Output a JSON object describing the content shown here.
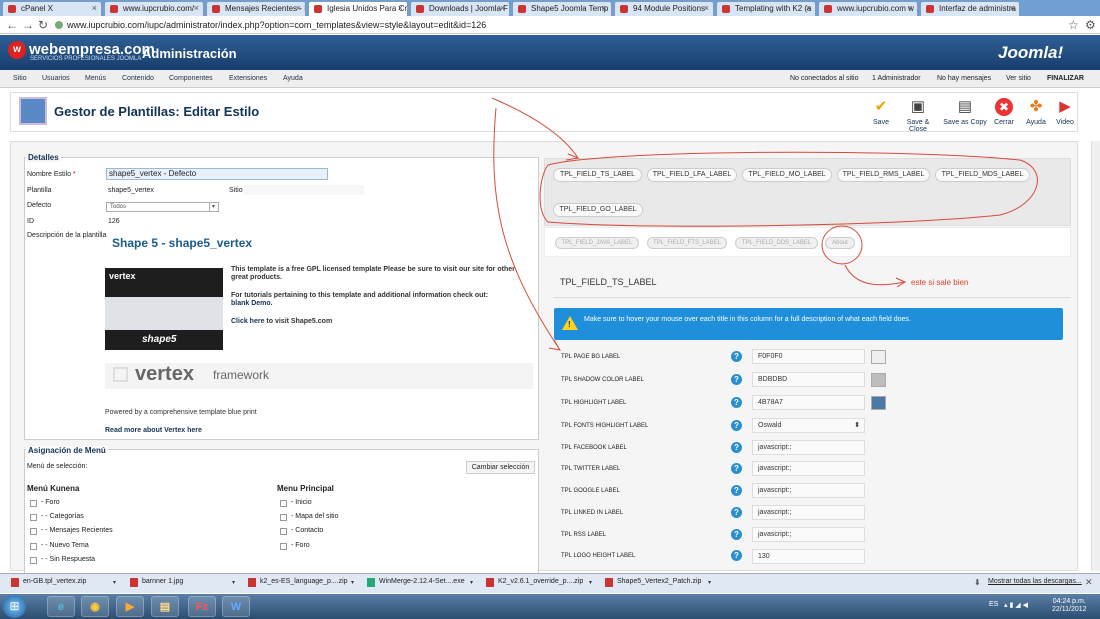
{
  "browser": {
    "tabs": [
      {
        "label": "cPanel X"
      },
      {
        "label": "www.iupcrubio.com/"
      },
      {
        "label": "Mensajes Recientes - I"
      },
      {
        "label": "Iglesia Unidos Para Cr"
      },
      {
        "label": "Downloads | Joomla F"
      },
      {
        "label": "Shape5 Joomla Temp"
      },
      {
        "label": "94 Module Positions"
      },
      {
        "label": "Templating with K2 (a"
      },
      {
        "label": "www.iupcrubio.com w"
      },
      {
        "label": "Interfaz de administra"
      }
    ],
    "url": "www.iupcrubio.com/iupc/administrator/index.php?option=com_templates&view=style&layout=edit&id=126"
  },
  "header": {
    "brand": "webempresa.com",
    "brand_sub": "SERVICIOS PROFESIONALES JOOMLA",
    "title": "Administración",
    "joomla": "Joomla!"
  },
  "menu": [
    "Sitio",
    "Usuarios",
    "Menús",
    "Contenido",
    "Componentes",
    "Extensiones",
    "Ayuda"
  ],
  "status": {
    "not_connected": "No conectados al sitio",
    "admins": "1 Administrador",
    "messages": "No hay mensajes",
    "view_site": "Ver sitio",
    "logout": "FINALIZAR"
  },
  "toolbar": {
    "page_title": "Gestor de Plantillas: Editar Estilo",
    "buttons": [
      {
        "label": "Save"
      },
      {
        "label": "Save & Close"
      },
      {
        "label": "Save as Copy"
      },
      {
        "label": "Cerrar"
      },
      {
        "label": "Ayuda"
      },
      {
        "label": "Video"
      }
    ]
  },
  "details": {
    "legend": "Detalles",
    "nombre_label": "Nombre Estilo",
    "required_mark": "*",
    "nombre_value": "shape5_vertex - Defecto",
    "plantilla_label": "Plantilla",
    "plantilla_value": "shape5_vertex",
    "sitio_label": "Sitio",
    "defecto_label": "Defecto",
    "defecto_value": "Todos",
    "id_label": "ID",
    "id_value": "126",
    "desc_label": "Descripción de la plantilla",
    "tpl_name": "Shape 5 - shape5_vertex",
    "image_text": "vertex",
    "image_sub": "shape5",
    "desc1": "This template is a free GPL licensed template Please be sure to visit our site for other great products.",
    "desc2": "For tutorials pertaining to this template and additional information check out:",
    "desc2_link": "blank Demo.",
    "desc3_link": "Click here",
    "desc3": "to visit Shape5.com",
    "vertex_word": "vertex",
    "framework_word": "framework",
    "powered": "Powered by a comprehensive template blue print",
    "read_more": "Read more about Vertex here"
  },
  "assign": {
    "legend": "Asignación de Menú",
    "select_label": "Menú de selección:",
    "change_btn": "Cambiar selección",
    "col1_title": "Menú Kunena",
    "col1": [
      "- Foro",
      "- - Categorías",
      "- - Mensajes Recientes",
      "- - Nuevo Tema",
      "- - Sin Respuesta"
    ],
    "col2_title": "Menu Principal",
    "col2": [
      "- Inicio",
      "- Mapa del sitio",
      "- Contacto",
      "- Foro"
    ]
  },
  "params": {
    "tabs_row1": [
      "TPL_FIELD_TS_LABEL",
      "TPL_FIELD_LFA_LABEL",
      "TPL_FIELD_MO_LABEL",
      "TPL_FIELD_RMS_LABEL",
      "TPL_FIELD_MDS_LABEL"
    ],
    "tabs_row2": [
      "TPL_FIELD_GO_LABEL"
    ],
    "tabs_row3": [
      "TPL_FIELD_JAVA_LABEL",
      "TPL_FIELD_FTS_LABEL",
      "TPL_FIELD_DDS_LABEL",
      "About"
    ],
    "heading": "TPL_FIELD_TS_LABEL",
    "info": "Make sure to hover your mouse over each title in this column for a full description of what each field does.",
    "fields": [
      {
        "label": "TPL PAGE BG LABEL",
        "value": "F0F0F0",
        "swatch": "#F0F0F0"
      },
      {
        "label": "TPL SHADOW COLOR LABEL",
        "value": "BDBDBD",
        "swatch": "#BDBDBD"
      },
      {
        "label": "TPL HIGHLIGHT LABEL",
        "value": "4B78A7",
        "swatch": "#4B78A7"
      },
      {
        "label": "TPL FONTS HIGHLIGHT LABEL",
        "value": "Oswald"
      },
      {
        "label": "TPL FACEBOOK LABEL",
        "value": "javascript:;"
      },
      {
        "label": "TPL TWITTER LABEL",
        "value": "javascript:;"
      },
      {
        "label": "TPL GOOGLE LABEL",
        "value": "javascript:;"
      },
      {
        "label": "TPL LINKED IN LABEL",
        "value": "javascript:;"
      },
      {
        "label": "TPL RSS LABEL",
        "value": "javascript:;"
      },
      {
        "label": "TPL LOGO HEIGHT LABEL",
        "value": "130"
      }
    ]
  },
  "annotation": "este si sale bien",
  "downloads": {
    "items": [
      "en-GB.tpl_vertex.zip",
      "barnner 1.jpg",
      "k2_es-ES_language_p....zip",
      "WinMerge-2.12.4-Set....exe",
      "K2_v2.6.1_override_p....zip",
      "Shape5_Vertex2_Patch.zip"
    ],
    "show_all": "Mostrar todas las descargas..."
  },
  "taskbar": {
    "lang": "ES",
    "time": "04:24 p.m.",
    "date": "22/11/2012"
  }
}
